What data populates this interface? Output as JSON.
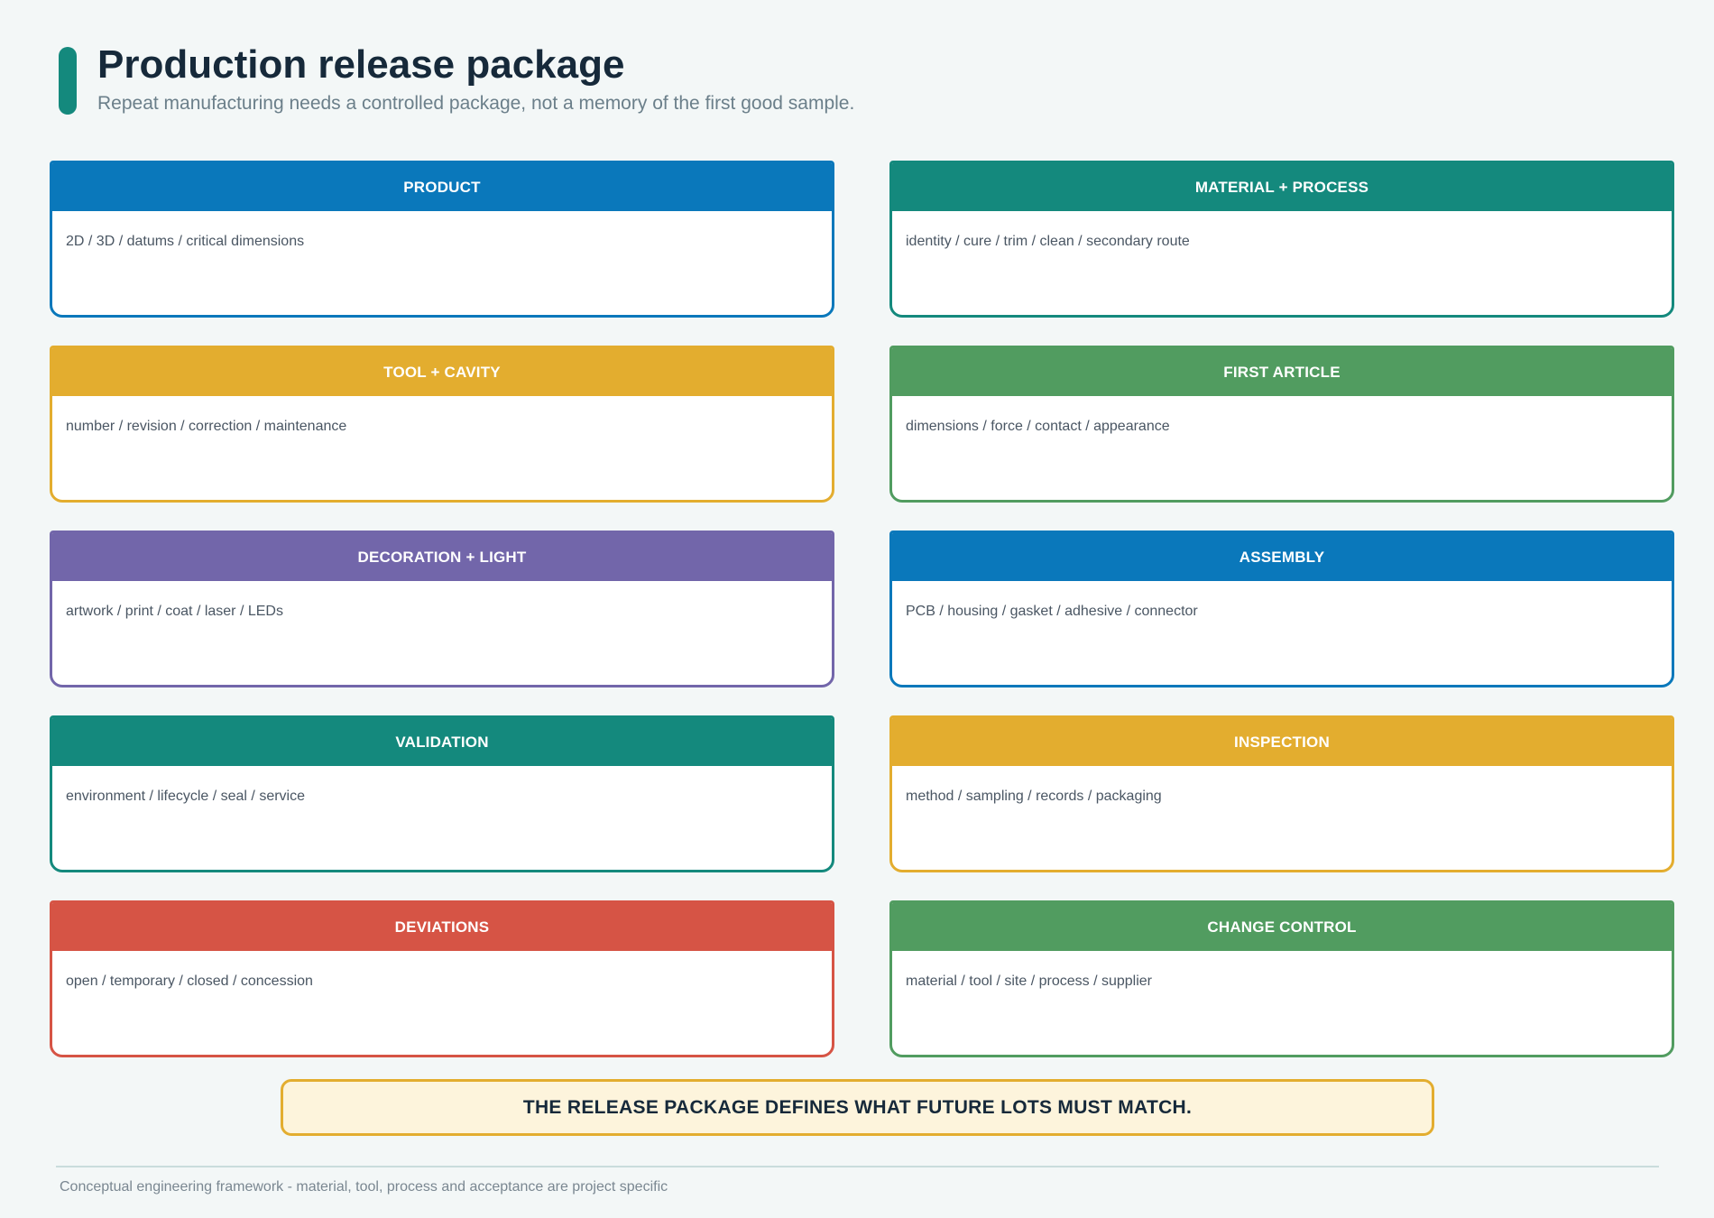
{
  "header": {
    "title": "Production release package",
    "subtitle": "Repeat manufacturing needs a controlled package, not a memory of the first good sample.",
    "accent_color": "#14897d"
  },
  "cards": [
    {
      "title": "PRODUCT",
      "body": "2D / 3D / datums / critical dimensions",
      "color": "#0a78bb"
    },
    {
      "title": "MATERIAL + PROCESS",
      "body": "identity / cure / trim / clean / secondary route",
      "color": "#14897d"
    },
    {
      "title": "TOOL + CAVITY",
      "body": "number / revision / correction / maintenance",
      "color": "#e3ad2f"
    },
    {
      "title": "FIRST ARTICLE",
      "body": "dimensions / force / contact / appearance",
      "color": "#519c60"
    },
    {
      "title": "DECORATION + LIGHT",
      "body": "artwork / print / coat / laser / LEDs",
      "color": "#7266aa"
    },
    {
      "title": "ASSEMBLY",
      "body": "PCB / housing / gasket / adhesive / connector",
      "color": "#0a78bb"
    },
    {
      "title": "VALIDATION",
      "body": "environment / lifecycle / seal / service",
      "color": "#14897d"
    },
    {
      "title": "INSPECTION",
      "body": "method / sampling / records / packaging",
      "color": "#e3ad2f"
    },
    {
      "title": "DEVIATIONS",
      "body": "open / temporary / closed / concession",
      "color": "#d65445"
    },
    {
      "title": "CHANGE CONTROL",
      "body": "material / tool / site / process / supplier",
      "color": "#519c60"
    }
  ],
  "callout": {
    "text": "THE RELEASE PACKAGE DEFINES WHAT FUTURE LOTS MUST MATCH.",
    "border_color": "#e3ad2f",
    "fill_color": "#fdf4dc"
  },
  "footer": {
    "note": "Conceptual engineering framework - material, tool, process and acceptance are project specific"
  }
}
